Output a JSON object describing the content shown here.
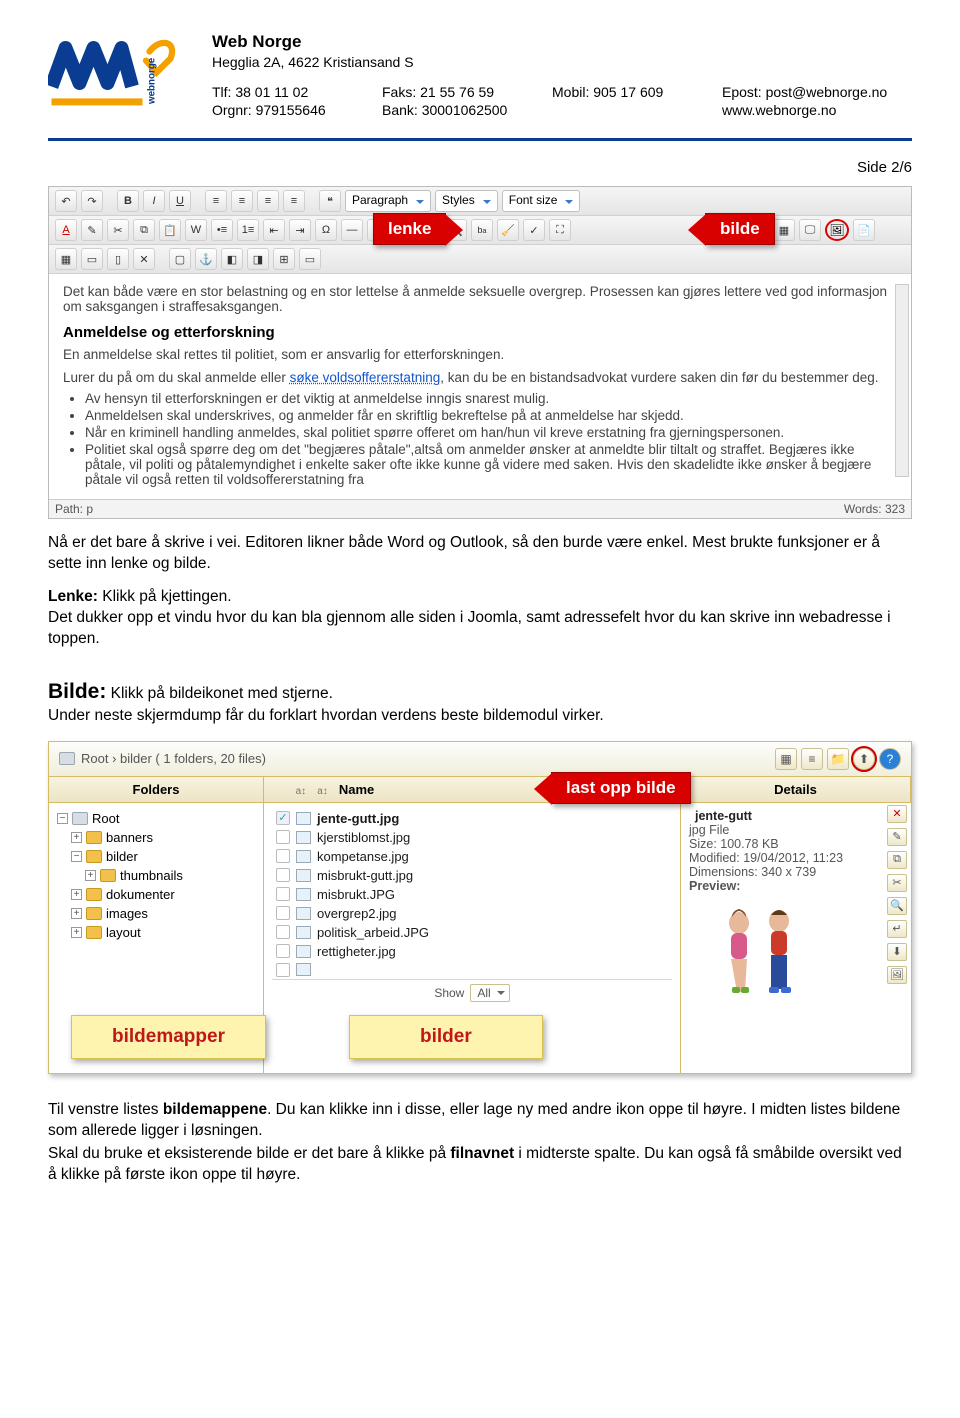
{
  "header": {
    "company": "Web Norge",
    "address": "Hegglia 2A, 4622 Kristiansand S",
    "row1": {
      "tlf_label": "Tlf: 38 01 11 02",
      "fax_label": "Faks: 21 55 76 59",
      "mobil_label": "Mobil: 905 17 609",
      "epost_label": "Epost: post@webnorge.no"
    },
    "row2": {
      "org_label": "Orgnr: 979155646",
      "bank_label": "Bank: 30001062500",
      "blank": "",
      "web_label": "www.webnorge.no"
    }
  },
  "page_number": "Side 2/6",
  "editor": {
    "annot_lenke": "lenke",
    "annot_bilde": "bilde",
    "dd_paragraph": "Paragraph",
    "dd_styles": "Styles",
    "dd_fontsize": "Font size",
    "line_intro": "Det kan både være en stor belastning og en stor lettelse å anmelde seksuelle overgrep. Prosessen kan gjøres lettere ved god informasjon om saksgangen i straffesaksgangen.",
    "heading": "Anmeldelse og etterforskning",
    "line_politi": "En anmeldelse skal rettes til politiet, som er ansvarlig for etterforskningen.",
    "line_lurer_pre": "Lurer du på om du skal anmelde eller ",
    "line_lurer_link": "søke voldsoffererstatning",
    "line_lurer_post": ", kan du be en bistandsadvokat vurdere saken din før du bestemmer deg.",
    "bullets": {
      "b1": "Av hensyn til etterforskningen er det viktig at anmeldelse inngis snarest mulig.",
      "b2": "Anmeldelsen skal underskrives, og anmelder får en skriftlig bekreftelse på at anmeldelse har skjedd.",
      "b3": "Når en kriminell handling anmeldes, skal politiet spørre offeret om han/hun vil kreve erstatning fra gjerningspersonen.",
      "b4": "Politiet skal også spørre deg om det \"begjæres påtale\",altså om anmelder ønsker at anmeldte blir tiltalt og straffet. Begjæres ikke påtale, vil politi og påtalemyndighet i enkelte saker ofte ikke kunne gå videre med saken. Hvis den skadelidte ikke ønsker å begjære påtale vil også retten til voldsoffererstatning fra"
    },
    "path": "Path: p",
    "words": "Words: 323"
  },
  "body": {
    "p1": "Nå er det bare å skrive i vei. Editoren likner både Word og Outlook, så den burde være enkel. Mest brukte funksjoner er å sette inn lenke og bilde.",
    "lenke_bold": "Lenke:",
    "lenke_rest": " Klikk på kjettingen.",
    "lenke_p2": "Det dukker opp et vindu hvor du kan bla gjennom alle siden i Joomla, samt adressefelt hvor du kan skrive inn webadresse i toppen.",
    "bilde_bold": "Bilde:",
    "bilde_rest": " Klikk på bildeikonet med stjerne.",
    "bilde_p2": "Under neste skjermdump får du forklart hvordan verdens beste bildemodul virker."
  },
  "filebrowser": {
    "breadcrumb": "Root › bilder  ( 1 folders, 20 files)",
    "annot_upload": "last opp bilde",
    "col_folders": "Folders",
    "col_name": "Name",
    "col_details": "Details",
    "tree": {
      "root": "Root",
      "banners": "banners",
      "bilder": "bilder",
      "thumbnails": "thumbnails",
      "dokumenter": "dokumenter",
      "images": "images",
      "layout": "layout"
    },
    "files": [
      "jente-gutt.jpg",
      "kjerstiblomst.jpg",
      "kompetanse.jpg",
      "misbrukt-gutt.jpg",
      "misbrukt.JPG",
      "overgrep2.jpg",
      "politisk_arbeid.JPG",
      "rettigheter.jpg"
    ],
    "details": {
      "filename": "jente-gutt",
      "filetype": "jpg File",
      "size": "Size: 100.78 KB",
      "modified": "Modified: 19/04/2012, 11:23",
      "dimensions": "Dimensions: 340 x 739",
      "preview_label": "Preview:"
    },
    "show_label": "Show",
    "show_value": "All",
    "annot_folders": "bildemapper",
    "annot_files": "bilder"
  },
  "footer": {
    "p1_pre": "Til venstre listes ",
    "p1_bold": "bildemappene",
    "p1_post": ". Du kan klikke inn i disse, eller lage ny med andre ikon oppe til høyre. I midten listes bildene som allerede ligger i løsningen.",
    "p2_pre": "Skal du bruke et eksisterende bilde er det bare å klikke på ",
    "p2_bold": "filnavnet",
    "p2_post": " i midterste spalte. Du kan også få småbilde oversikt ved å klikke på første ikon oppe til høyre."
  }
}
